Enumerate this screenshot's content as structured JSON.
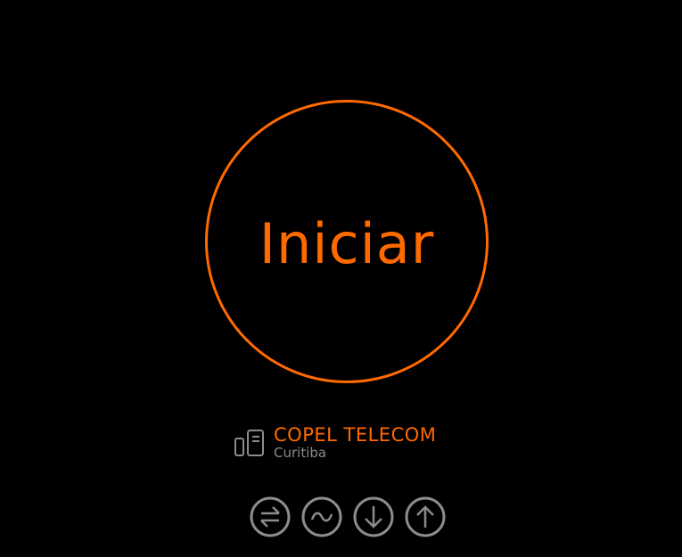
{
  "main_button": {
    "label": "Iniciar"
  },
  "server": {
    "name": "COPEL TELECOM",
    "location": "Curitiba",
    "icon": "server-devices-icon"
  },
  "metrics": [
    {
      "icon": "ping-icon"
    },
    {
      "icon": "jitter-icon"
    },
    {
      "icon": "download-icon"
    },
    {
      "icon": "upload-icon"
    }
  ],
  "colors": {
    "accent": "#ff6a00",
    "muted": "#8c8c8c",
    "background": "#000000"
  }
}
